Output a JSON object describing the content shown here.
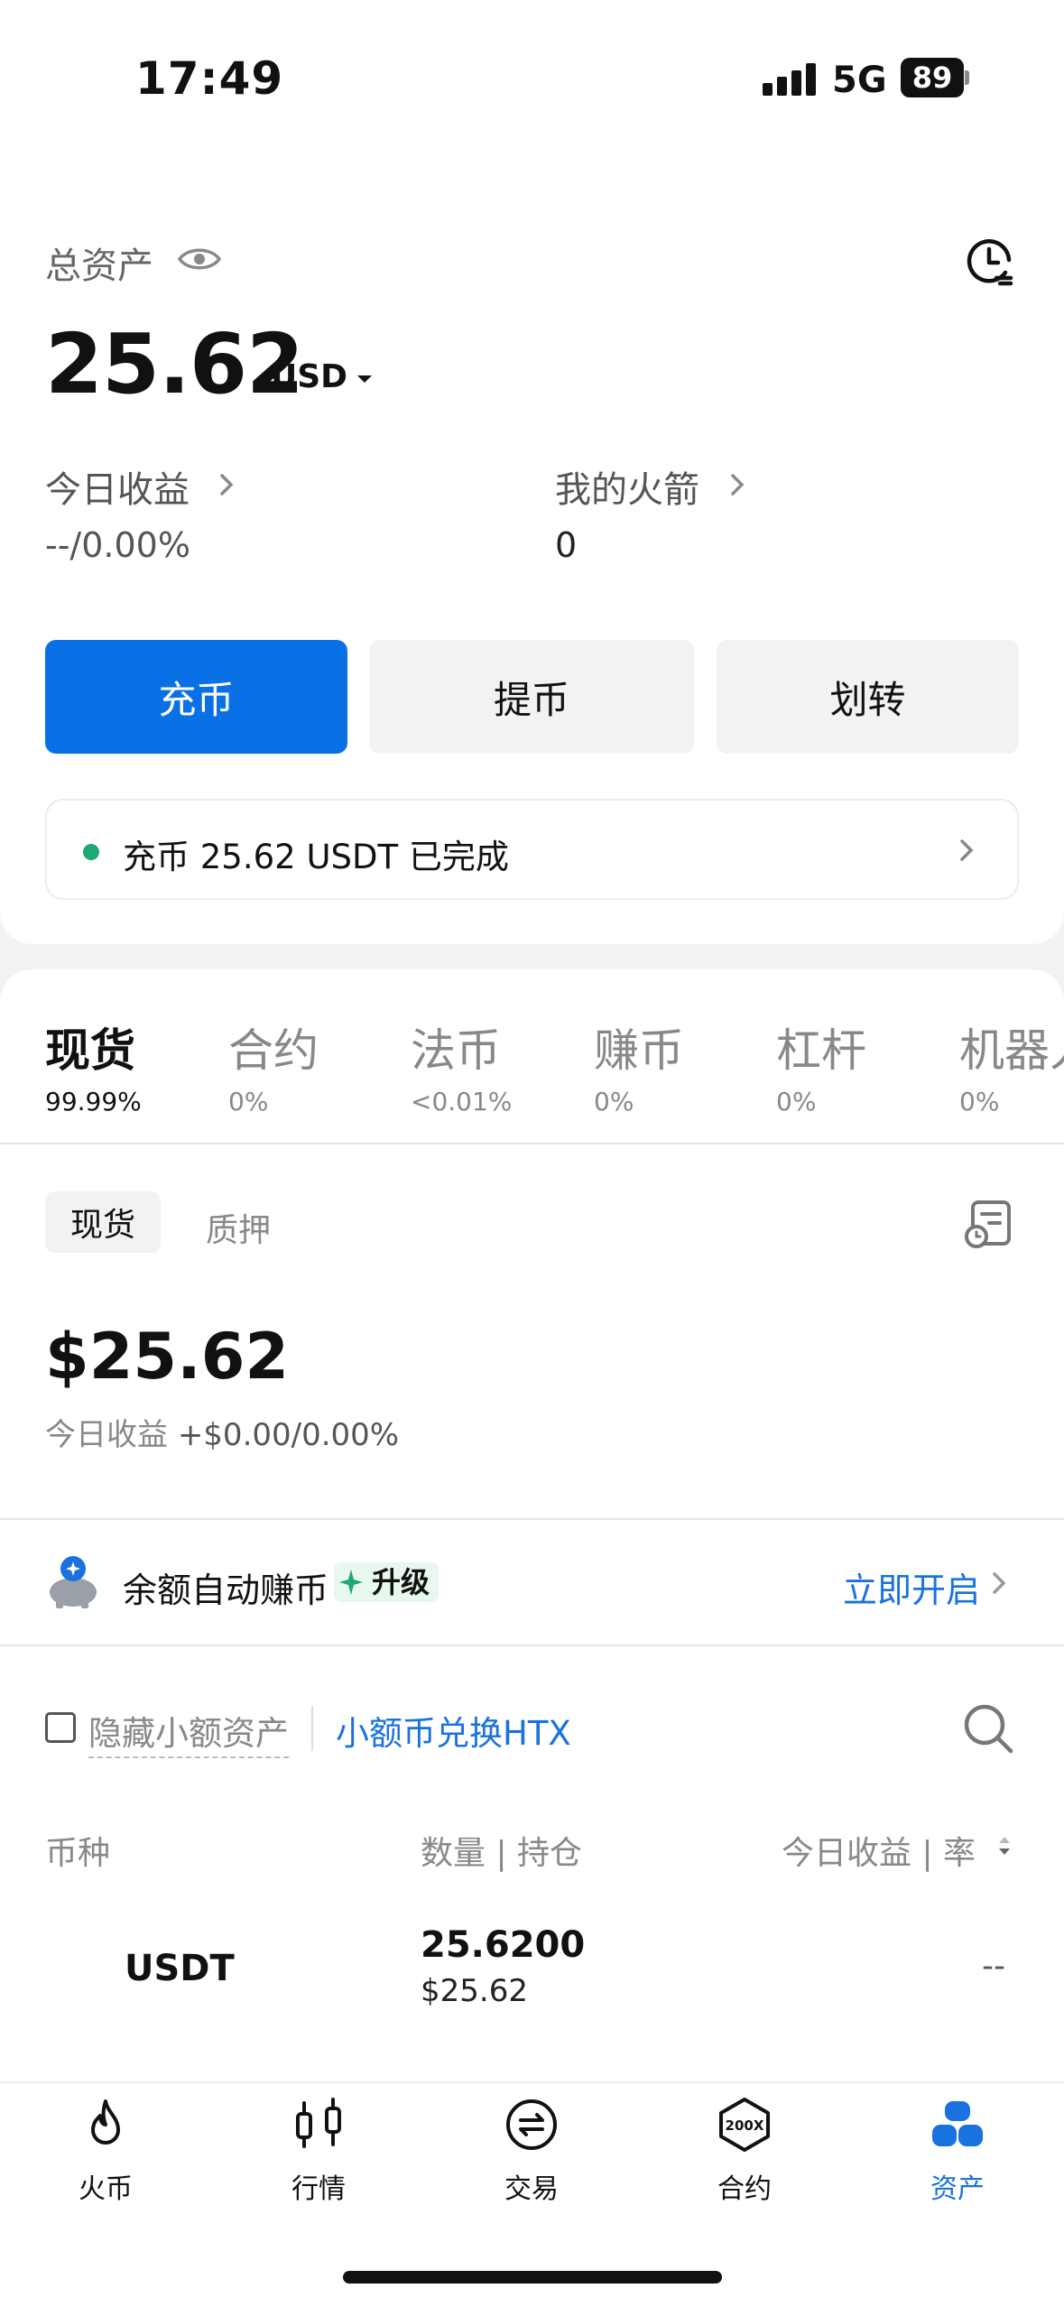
{
  "status": {
    "time": "17:49",
    "network": "5G",
    "battery": "89"
  },
  "header": {
    "total_label": "总资产",
    "balance": "25.62",
    "currency": "USD",
    "today_label": "今日收益",
    "today_value": "--/0.00%",
    "rocket_label": "我的火箭",
    "rocket_value": "0"
  },
  "actions": {
    "deposit": "充币",
    "withdraw": "提币",
    "transfer": "划转"
  },
  "notice": {
    "text": "充币 25.62 USDT 已完成",
    "dot_color": "#1fa774"
  },
  "categories": [
    {
      "name": "现货",
      "pct": "99.99%"
    },
    {
      "name": "合约",
      "pct": "0%"
    },
    {
      "name": "法币",
      "pct": "<0.01%"
    },
    {
      "name": "赚币",
      "pct": "0%"
    },
    {
      "name": "杠杆",
      "pct": "0%"
    },
    {
      "name": "机器人",
      "pct": "0%"
    }
  ],
  "subtabs": {
    "spot": "现货",
    "pledge": "质押"
  },
  "spot": {
    "balance": "$25.62",
    "today_label": "今日收益",
    "today_value": "+$0.00/0.00%"
  },
  "earn": {
    "text": "余额自动赚币",
    "badge": "升级",
    "link": "立即开启"
  },
  "filters": {
    "hide_small": "隐藏小额资产",
    "convert": "小额币兑换HTX"
  },
  "table": {
    "headers": {
      "coin": "币种",
      "qty": "数量 | 持仓",
      "pnl": "今日收益 | 率"
    },
    "rows": [
      {
        "coin": "USDT",
        "qty": "25.6200",
        "usd": "$25.62",
        "pnl": "--"
      }
    ]
  },
  "nav": [
    {
      "label": "火币",
      "icon": "flame-icon"
    },
    {
      "label": "行情",
      "icon": "candlestick-icon"
    },
    {
      "label": "交易",
      "icon": "exchange-icon"
    },
    {
      "label": "合约",
      "icon": "contract-200x-icon"
    },
    {
      "label": "资产",
      "icon": "assets-icon"
    }
  ],
  "colors": {
    "primary": "#0a70e5",
    "link": "#1a72e0",
    "success": "#1fa774"
  }
}
